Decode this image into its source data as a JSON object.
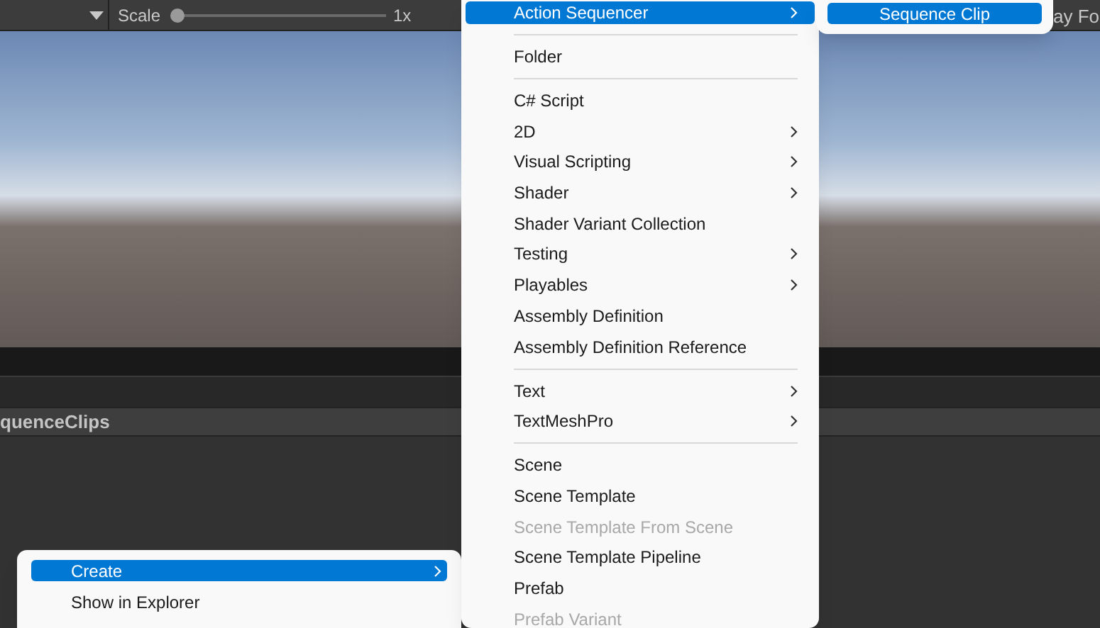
{
  "toolbar": {
    "scale_label": "Scale",
    "scale": {
      "level": 0.0
    },
    "scale_value": "1x",
    "right_text": "ay Fo"
  },
  "project_panel": {
    "breadcrumb": "quenceClips"
  },
  "context_menu": {
    "items": [
      {
        "kind": "item",
        "label": "Create",
        "selected": true,
        "disabled": false,
        "submenu": true
      },
      {
        "kind": "item",
        "label": "Show in Explorer",
        "selected": false,
        "disabled": false,
        "submenu": false
      }
    ]
  },
  "create_menu": {
    "items": [
      {
        "kind": "item",
        "label": "Action Sequencer",
        "selected": true,
        "disabled": false,
        "submenu": true
      },
      {
        "kind": "separator"
      },
      {
        "kind": "item",
        "label": "Folder",
        "selected": false,
        "disabled": false,
        "submenu": false
      },
      {
        "kind": "separator"
      },
      {
        "kind": "item",
        "label": "C# Script",
        "selected": false,
        "disabled": false,
        "submenu": false
      },
      {
        "kind": "item",
        "label": "2D",
        "selected": false,
        "disabled": false,
        "submenu": true
      },
      {
        "kind": "item",
        "label": "Visual Scripting",
        "selected": false,
        "disabled": false,
        "submenu": true
      },
      {
        "kind": "item",
        "label": "Shader",
        "selected": false,
        "disabled": false,
        "submenu": true
      },
      {
        "kind": "item",
        "label": "Shader Variant Collection",
        "selected": false,
        "disabled": false,
        "submenu": false
      },
      {
        "kind": "item",
        "label": "Testing",
        "selected": false,
        "disabled": false,
        "submenu": true
      },
      {
        "kind": "item",
        "label": "Playables",
        "selected": false,
        "disabled": false,
        "submenu": true
      },
      {
        "kind": "item",
        "label": "Assembly Definition",
        "selected": false,
        "disabled": false,
        "submenu": false
      },
      {
        "kind": "item",
        "label": "Assembly Definition Reference",
        "selected": false,
        "disabled": false,
        "submenu": false
      },
      {
        "kind": "separator"
      },
      {
        "kind": "item",
        "label": "Text",
        "selected": false,
        "disabled": false,
        "submenu": true
      },
      {
        "kind": "item",
        "label": "TextMeshPro",
        "selected": false,
        "disabled": false,
        "submenu": true
      },
      {
        "kind": "separator"
      },
      {
        "kind": "item",
        "label": "Scene",
        "selected": false,
        "disabled": false,
        "submenu": false
      },
      {
        "kind": "item",
        "label": "Scene Template",
        "selected": false,
        "disabled": false,
        "submenu": false
      },
      {
        "kind": "item",
        "label": "Scene Template From Scene",
        "selected": false,
        "disabled": true,
        "submenu": false
      },
      {
        "kind": "item",
        "label": "Scene Template Pipeline",
        "selected": false,
        "disabled": false,
        "submenu": false
      },
      {
        "kind": "item",
        "label": "Prefab",
        "selected": false,
        "disabled": false,
        "submenu": false
      },
      {
        "kind": "item",
        "label": "Prefab Variant",
        "selected": false,
        "disabled": true,
        "submenu": false
      }
    ]
  },
  "sub_menu": {
    "items": [
      {
        "kind": "item",
        "label": "Sequence Clip",
        "selected": true,
        "submenu": false
      }
    ]
  }
}
